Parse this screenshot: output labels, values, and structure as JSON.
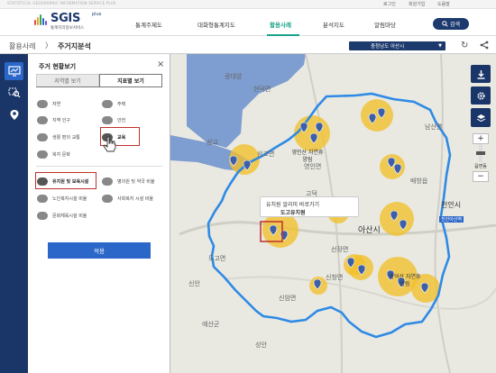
{
  "header": {
    "tagline": "STATISTICAL GEOGRAPHIC INFORMATION SERVICE PLUS",
    "util": [
      "로그인",
      "회원가입",
      "도움말"
    ],
    "logo_main": "SGIS",
    "logo_plus": "plus",
    "logo_sub": "통계지리정보서비스",
    "nav": [
      "통계주제도",
      "대화형통계지도",
      "활용사례",
      "분석지도",
      "알림마당"
    ],
    "active_nav": "활용사례",
    "search_label": "검색"
  },
  "breadcrumb": {
    "items": [
      "활용사례",
      "주거지분석"
    ],
    "separator": "〉"
  },
  "region_select": {
    "value": "충청남도 아산시"
  },
  "rail": {
    "icons": [
      "map-stats-icon",
      "zoom-search-icon",
      "location-pin-icon"
    ]
  },
  "panel": {
    "title": "주거 현황보기",
    "close": "×",
    "tabs": [
      "지역별 보기",
      "지표별 보기"
    ],
    "active_tab": "지표별 보기",
    "items_left": [
      "자연",
      "지역 인구",
      "생활 편의 교통",
      "복지 문화",
      "유치원 및 보육시설",
      "노인복지시설 비율",
      "문화체육시설 비율"
    ],
    "items_right": [
      "주택",
      "안전",
      "교육",
      "병의원 및 약국 비율",
      "사회복지 시설 비율"
    ],
    "highlighted": [
      "교육",
      "유치원 및 보육시설"
    ],
    "apply_label": "적용"
  },
  "map": {
    "labels": [
      "광대암",
      "현덕면",
      "삼교",
      "삼교면",
      "영인면",
      "고덕",
      "영인산 자연휴양림",
      "도고면",
      "아산시",
      "신창면",
      "선장면",
      "신암면",
      "예산군",
      "천안시",
      "신안",
      "남산면",
      "배방읍",
      "광덕산 자연휴양림",
      "천안아산역",
      "성안"
    ],
    "callout_line1": "유치원 알리미 바로가기",
    "callout_line2": "도고유치원",
    "zoom_in": "+",
    "zoom_out": "−",
    "zoom_label": "읍면동"
  },
  "colors": {
    "navy": "#1a3668",
    "accent_blue": "#2a67c9",
    "active_nav": "#1aa38a",
    "boundary": "#2f8ae5",
    "cluster": "#f2c02a",
    "highlight": "#c0302c",
    "water": "#7e9dd0"
  }
}
